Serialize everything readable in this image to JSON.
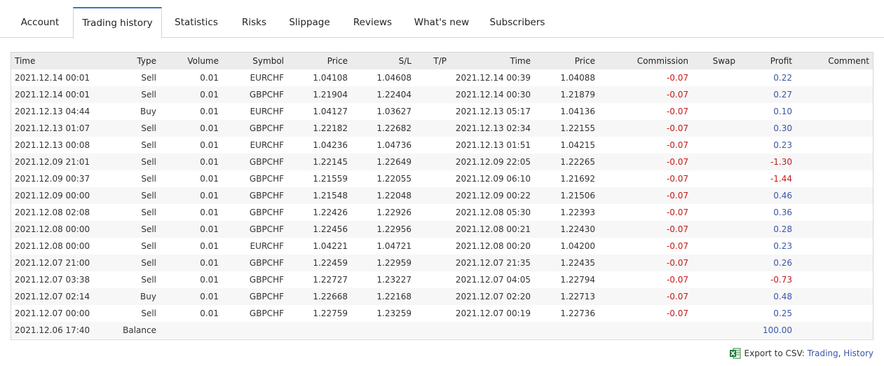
{
  "tabs": [
    {
      "label": "Account"
    },
    {
      "label": "Trading history",
      "active": true
    },
    {
      "label": "Statistics"
    },
    {
      "label": "Risks"
    },
    {
      "label": "Slippage"
    },
    {
      "label": "Reviews"
    },
    {
      "label": "What's new"
    },
    {
      "label": "Subscribers"
    }
  ],
  "table": {
    "columns": [
      "Time",
      "Type",
      "Volume",
      "Symbol",
      "Price",
      "S/L",
      "T/P",
      "Time",
      "Price",
      "Commission",
      "Swap",
      "Profit",
      "Comment"
    ],
    "rows": [
      [
        "2021.12.14 00:01",
        "Sell",
        "0.01",
        "EURCHF",
        "1.04108",
        "1.04608",
        "",
        "2021.12.14 00:39",
        "1.04088",
        "-0.07",
        "",
        "0.22",
        ""
      ],
      [
        "2021.12.14 00:01",
        "Sell",
        "0.01",
        "GBPCHF",
        "1.21904",
        "1.22404",
        "",
        "2021.12.14 00:30",
        "1.21879",
        "-0.07",
        "",
        "0.27",
        ""
      ],
      [
        "2021.12.13 04:44",
        "Buy",
        "0.01",
        "EURCHF",
        "1.04127",
        "1.03627",
        "",
        "2021.12.13 05:17",
        "1.04136",
        "-0.07",
        "",
        "0.10",
        ""
      ],
      [
        "2021.12.13 01:07",
        "Sell",
        "0.01",
        "GBPCHF",
        "1.22182",
        "1.22682",
        "",
        "2021.12.13 02:34",
        "1.22155",
        "-0.07",
        "",
        "0.30",
        ""
      ],
      [
        "2021.12.13 00:08",
        "Sell",
        "0.01",
        "EURCHF",
        "1.04236",
        "1.04736",
        "",
        "2021.12.13 01:51",
        "1.04215",
        "-0.07",
        "",
        "0.23",
        ""
      ],
      [
        "2021.12.09 21:01",
        "Sell",
        "0.01",
        "GBPCHF",
        "1.22145",
        "1.22649",
        "",
        "2021.12.09 22:05",
        "1.22265",
        "-0.07",
        "",
        "-1.30",
        ""
      ],
      [
        "2021.12.09 00:37",
        "Sell",
        "0.01",
        "GBPCHF",
        "1.21559",
        "1.22055",
        "",
        "2021.12.09 06:10",
        "1.21692",
        "-0.07",
        "",
        "-1.44",
        ""
      ],
      [
        "2021.12.09 00:00",
        "Sell",
        "0.01",
        "GBPCHF",
        "1.21548",
        "1.22048",
        "",
        "2021.12.09 00:22",
        "1.21506",
        "-0.07",
        "",
        "0.46",
        ""
      ],
      [
        "2021.12.08 02:08",
        "Sell",
        "0.01",
        "GBPCHF",
        "1.22426",
        "1.22926",
        "",
        "2021.12.08 05:30",
        "1.22393",
        "-0.07",
        "",
        "0.36",
        ""
      ],
      [
        "2021.12.08 00:00",
        "Sell",
        "0.01",
        "GBPCHF",
        "1.22456",
        "1.22956",
        "",
        "2021.12.08 00:21",
        "1.22430",
        "-0.07",
        "",
        "0.28",
        ""
      ],
      [
        "2021.12.08 00:00",
        "Sell",
        "0.01",
        "EURCHF",
        "1.04221",
        "1.04721",
        "",
        "2021.12.08 00:20",
        "1.04200",
        "-0.07",
        "",
        "0.23",
        ""
      ],
      [
        "2021.12.07 21:00",
        "Sell",
        "0.01",
        "GBPCHF",
        "1.22459",
        "1.22959",
        "",
        "2021.12.07 21:35",
        "1.22435",
        "-0.07",
        "",
        "0.26",
        ""
      ],
      [
        "2021.12.07 03:38",
        "Sell",
        "0.01",
        "GBPCHF",
        "1.22727",
        "1.23227",
        "",
        "2021.12.07 04:05",
        "1.22794",
        "-0.07",
        "",
        "-0.73",
        ""
      ],
      [
        "2021.12.07 02:14",
        "Buy",
        "0.01",
        "GBPCHF",
        "1.22668",
        "1.22168",
        "",
        "2021.12.07 02:20",
        "1.22713",
        "-0.07",
        "",
        "0.48",
        ""
      ],
      [
        "2021.12.07 00:00",
        "Sell",
        "0.01",
        "GBPCHF",
        "1.22759",
        "1.23259",
        "",
        "2021.12.07 00:19",
        "1.22736",
        "-0.07",
        "",
        "0.25",
        ""
      ],
      [
        "2021.12.06 17:40",
        "Balance",
        "",
        "",
        "",
        "",
        "",
        "",
        "",
        "",
        "",
        "100.00",
        ""
      ]
    ]
  },
  "export": {
    "icon": "excel-icon",
    "label": "Export to CSV:",
    "link_trading": "Trading",
    "separator": ",",
    "link_history": "History"
  },
  "colors": {
    "accent": "#3f73ba",
    "negative": "#c21a1a",
    "positive": "#3a55a8",
    "header_bg": "#ececec",
    "alt_row_bg": "#f7f7f7"
  }
}
